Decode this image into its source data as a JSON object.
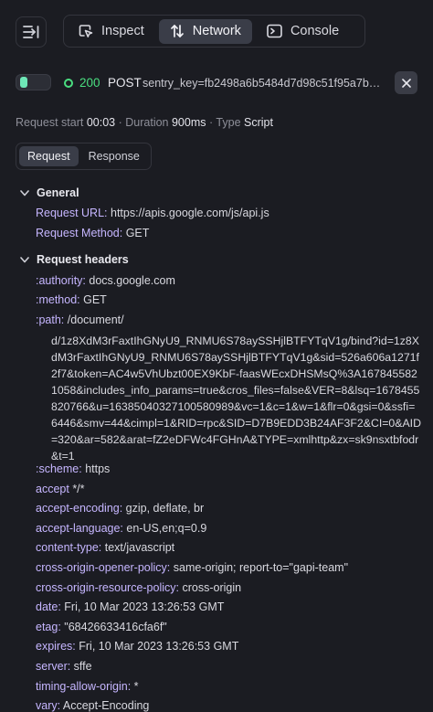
{
  "toolbar": {
    "tabs": [
      {
        "label": "Inspect",
        "icon": "inspect-icon"
      },
      {
        "label": "Network",
        "icon": "network-icon"
      },
      {
        "label": "Console",
        "icon": "console-icon"
      }
    ]
  },
  "request": {
    "status": "200",
    "method": "POST",
    "url": "sentry_key=fb2498a6b5484d7d98c51f95a7b…"
  },
  "meta": {
    "start_label": "Request start",
    "start_value": "00:03",
    "duration_label": "Duration",
    "duration_value": "900ms",
    "type_label": "Type",
    "type_value": "Script",
    "sep": "·"
  },
  "subtabs": [
    "Request",
    "Response"
  ],
  "general": {
    "title": "General",
    "request_url_key": "Request URL:",
    "request_url_value": "https://apis.google.com/js/api.js",
    "request_method_key": "Request Method:",
    "request_method_value": "GET"
  },
  "headers": {
    "title": "Request headers",
    "authority": {
      "k": ":authority:",
      "v": "docs.google.com"
    },
    "method": {
      "k": ":method:",
      "v": "GET"
    },
    "path": {
      "k": ":path:",
      "v": "/document/"
    },
    "path_continued": "d/1z8XdM3rFaxtIhGNyU9_RNMU6S78aySSHjlBTFYTqV1g/bind?id=1z8XdM3rFaxtIhGNyU9_RNMU6S78aySSHjlBTFYTqV1g&sid=526a606a1271f2f7&token=AC4w5VhUbzt00EX9KbF-faasWEcxDHSMsQ%3A1678455821058&includes_info_params=true&cros_files=false&VER=8&lsq=1678455820766&u=16385040327100580989&vc=1&c=1&w=1&flr=0&gsi=0&ssfi=6446&smv=44&cimpl=1&RID=rpc&SID=D7B9EDD3B24AF3F2&CI=0&AID=320&ar=582&arat=fZ2eDFWc4FGHnA&TYPE=xmlhttp&zx=sk9nsxtbfodr&t=1",
    "list": [
      {
        "k": ":scheme:",
        "v": "https"
      },
      {
        "k": "accept",
        "v": "*/*"
      },
      {
        "k": "accept-encoding:",
        "v": "gzip, deflate, br"
      },
      {
        "k": "accept-language:",
        "v": "en-US,en;q=0.9"
      },
      {
        "k": "content-type:",
        "v": "text/javascript"
      },
      {
        "k": "cross-origin-opener-policy:",
        "v": "same-origin; report-to=\"gapi-team\""
      },
      {
        "k": "cross-origin-resource-policy:",
        "v": "cross-origin"
      },
      {
        "k": "date:",
        "v": "Fri, 10 Mar 2023 13:26:53 GMT"
      },
      {
        "k": "etag:",
        "v": "\"68426633416cfa6f\""
      },
      {
        "k": "expires:",
        "v": "Fri, 10 Mar 2023 13:26:53 GMT"
      },
      {
        "k": "server:",
        "v": "sffe"
      },
      {
        "k": "timing-allow-origin:",
        "v": "*"
      },
      {
        "k": "vary:",
        "v": "Accept-Encoding"
      }
    ]
  },
  "colors": {
    "background": "#1b1c22",
    "accent_green": "#4ade80",
    "header_key": "#c6b6ff"
  }
}
